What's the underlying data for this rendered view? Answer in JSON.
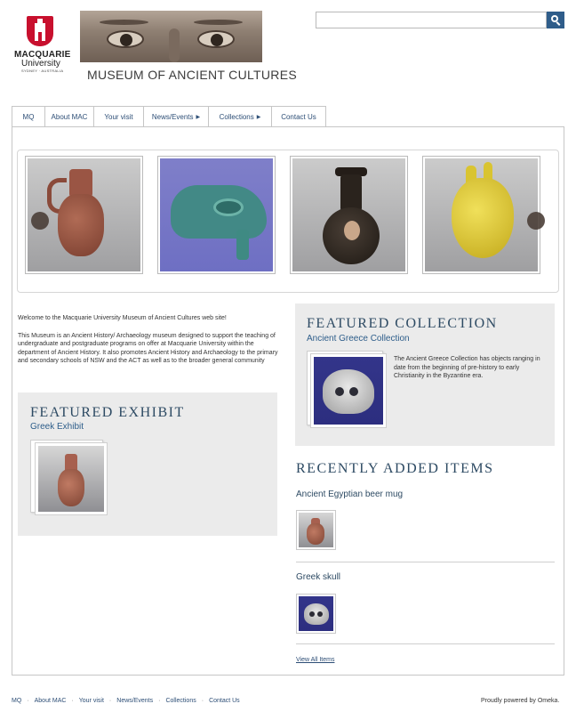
{
  "header": {
    "logo": {
      "name": "MACQUARIE",
      "subname": "University",
      "tagline": "SYDNEY · AUSTRALIA"
    },
    "site_title": "MUSEUM OF ANCIENT CULTURES",
    "search": {
      "value": "",
      "placeholder": "",
      "icon": "search-icon"
    },
    "accent_color": "#2f5d8a"
  },
  "nav": {
    "items": [
      {
        "label": "MQ",
        "has_submenu": false
      },
      {
        "label": "About MAC",
        "has_submenu": false
      },
      {
        "label": "Your visit",
        "has_submenu": false
      },
      {
        "label": "News/Events",
        "has_submenu": true
      },
      {
        "label": "Collections",
        "has_submenu": true
      },
      {
        "label": "Contact Us",
        "has_submenu": false
      }
    ]
  },
  "carousel": {
    "slides": [
      {
        "subject": "jug"
      },
      {
        "subject": "eye-amulet"
      },
      {
        "subject": "vase"
      },
      {
        "subject": "heart"
      }
    ],
    "prev_icon": "chevron-left-icon",
    "next_icon": "chevron-right-icon"
  },
  "intro": {
    "welcome": "Welcome to the Macquarie University Museum of Ancient Cultures web site!",
    "body": "This Museum is an Ancient History/ Archaeology museum designed to support the teaching of undergraduate and postgraduate programs on offer at Macquarie University within the department of Ancient History. It also promotes Ancient History and Archaeology to the primary and secondary schools of NSW and the ACT as well as to the broader general community"
  },
  "featured_exhibit": {
    "heading": "FEATURED EXHIBIT",
    "title": "Greek Exhibit"
  },
  "featured_collection": {
    "heading": "FEATURED COLLECTION",
    "title": "Ancient Greece Collection",
    "description": "The Ancient Greece Collection has objects ranging in date from the beginning of pre-history to early Christianity in the Byzantine era."
  },
  "recent_items": {
    "heading": "RECENTLY ADDED ITEMS",
    "items": [
      {
        "title": "Ancient Egyptian beer mug"
      },
      {
        "title": "Greek skull"
      }
    ],
    "view_all": "View All Items"
  },
  "footer": {
    "links": [
      "MQ",
      "About MAC",
      "Your visit",
      "News/Events",
      "Collections",
      "Contact Us"
    ],
    "powered_by": "Proudly powered by Omeka."
  }
}
